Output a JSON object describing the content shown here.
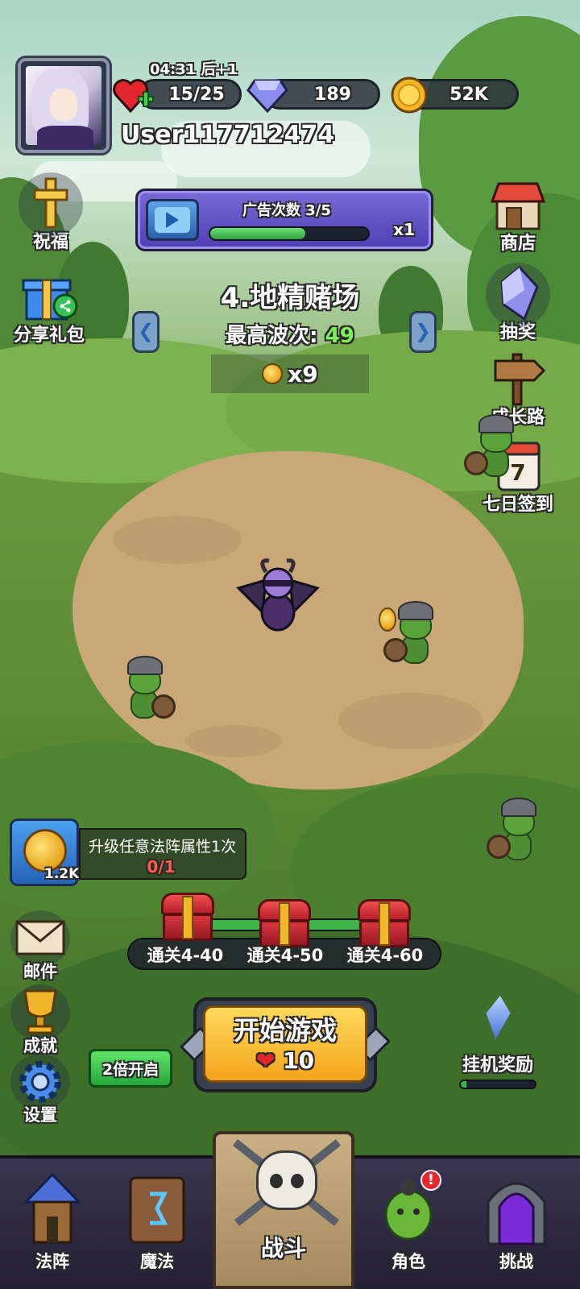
{
  "player": {
    "username": "User117712474",
    "energy_timer": "04:31 后+1",
    "energy": "15/25",
    "gems": "189",
    "gold": "52K"
  },
  "side_left": {
    "blessing": "祝福",
    "share_gift": "分享礼包"
  },
  "side_right": {
    "shop": "商店",
    "lottery": "抽奖",
    "growth_road": "成长路",
    "seven_day": "七日签到",
    "seven_day_number": "7"
  },
  "ad": {
    "title": "广告次数",
    "count": "3/5",
    "progress": 0.6,
    "multiplier": "x1"
  },
  "level": {
    "name": "4.地精赌场",
    "best_wave_label": "最高波次:",
    "best_wave_value": "49",
    "reward": "x9"
  },
  "quest": {
    "reward_amount": "1.2K",
    "title": "升级任意法阵属性1次",
    "progress": "0/1"
  },
  "chests": [
    {
      "label": "通关4-40"
    },
    {
      "label": "通关4-50"
    },
    {
      "label": "通关4-60"
    }
  ],
  "left_menu": {
    "mail": "邮件",
    "achievement": "成就",
    "settings": "设置"
  },
  "double_button": "2倍开启",
  "start": {
    "label": "开始游戏",
    "cost": "10"
  },
  "afk": {
    "label": "挂机奖励",
    "progress": 0.08
  },
  "nav": {
    "formation": "法阵",
    "magic": "魔法",
    "battle": "战斗",
    "character": "角色",
    "character_badge": "!",
    "challenge": "挑战"
  }
}
